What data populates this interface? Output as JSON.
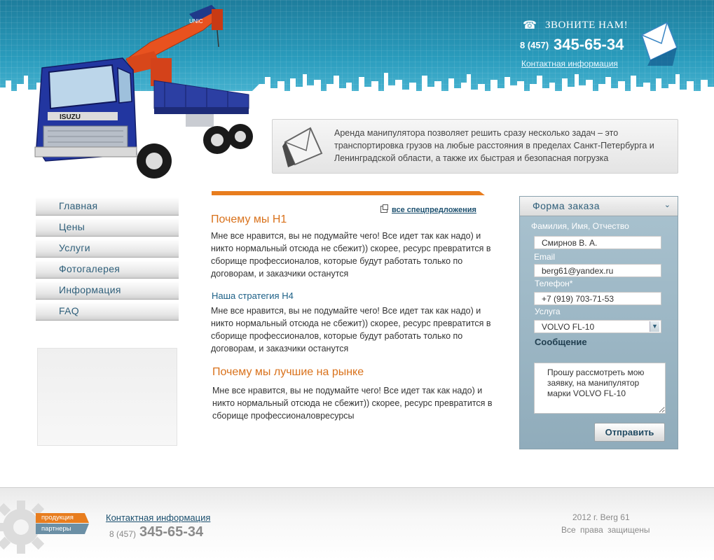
{
  "header": {
    "call_label": "ЗВОНИТЕ НАМ!",
    "phone_code": "8 (457)",
    "phone_number": "345-65-34",
    "contact_link": "Контактная информация",
    "intro_text": "Аренда манипулятора позволяет решить сразу несколько задач – это транспортировка грузов на любые расстояния в пределах Санкт-Петербурга и Ленинградской области, а также их быстрая и  безопасная погрузка",
    "truck_brand": "ISUZU",
    "crane_brand": "UNIC"
  },
  "menu": {
    "items": [
      {
        "label": "Главная"
      },
      {
        "label": "Цены"
      },
      {
        "label": "Услуги"
      },
      {
        "label": "Фотогалерея"
      },
      {
        "label": "Информация"
      },
      {
        "label": "FAQ"
      }
    ]
  },
  "content": {
    "specials_link": "все спецпредложения",
    "h1": "Почему мы H1",
    "p1": "Мне все нравится, вы не подумайте чего!  Все идет так как надо) и никто нормальный отсюда не сбежит)) скорее, ресурс превратится в сборище профессионалов, которые будут работать только по договорам, и заказчики останутся",
    "h4": "Наша стратегия H4",
    "p2": "Мне все нравится, вы не подумайте чего!  Все идет так как надо) и никто нормальный отсюда не сбежит)) скорее, ресурс превратится в сборище профессионалов, которые будут работать только по договорам, и заказчики останутся",
    "h_best": "Почему мы лучшие на рынке",
    "p3": "Мне все нравится, вы не подумайте чего!  Все идет так как надо) и никто нормальный отсюда не сбежит)) скорее, ресурс превратится в сборище профессионаловресурсы"
  },
  "order_form": {
    "title": "Форма заказа",
    "name_label": "Фамилия, Имя, Отчество",
    "name_value": "Смирнов В. А.",
    "email_label": "Email",
    "email_value": "berg61@yandex.ru",
    "phone_label": "Телефон*",
    "phone_value": "+7 (919) 703-71-53",
    "service_label": "Услуга",
    "service_value": "VOLVO FL-10",
    "message_label": "Сообщение",
    "message_value": "Прошу рассмотреть мою заявку, на манипулятор марки VOLVO FL-10",
    "submit_label": "Отправить"
  },
  "footer": {
    "tag_products": "продукция",
    "tag_partners": "партнеры",
    "contact_link": "Контактная информация",
    "phone_code": "8 (457)",
    "phone_number": "345-65-34",
    "copyright_line1": "2012 г. Berg 61",
    "copyright_line2": "Все  права  защищены"
  },
  "colors": {
    "accent_orange": "#e87d1e",
    "link_blue": "#1b4f6e",
    "header_teal": "#2a9cbd",
    "form_bg": "#9fb9c6"
  },
  "icons": [
    "phone-icon",
    "mail-icon",
    "chevron-down-icon",
    "window-icon",
    "gear-icon"
  ]
}
